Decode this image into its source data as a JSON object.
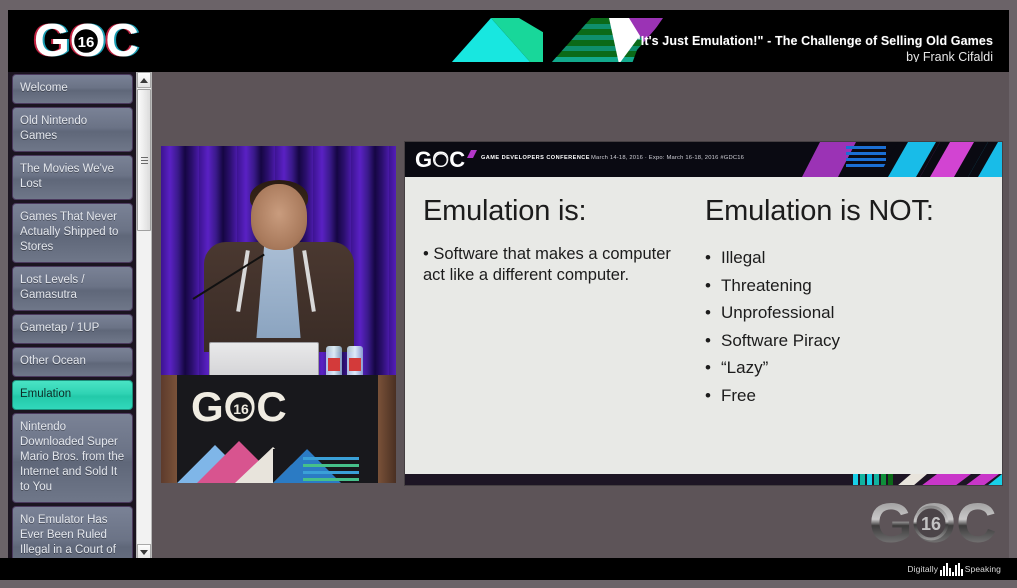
{
  "window": {
    "chrome_color": "#6b6368",
    "background_color": "#5d5458"
  },
  "header": {
    "logo_text": "GDC",
    "logo_year": "16",
    "title": "\"It's Just Emulation!\" - The Challenge of Selling Old Games",
    "subtitle": "by Frank Cifaldi",
    "background_color": "#000000",
    "accent_colors": [
      "#18e3d2",
      "#00b98a",
      "#0d6b1f",
      "#9b33b5",
      "#ffffff"
    ]
  },
  "sidebar": {
    "active_index": 7,
    "active_color": "#2fd3b4",
    "item_color": "#6b7386",
    "items": [
      {
        "label": "Welcome"
      },
      {
        "label": "Old Nintendo Games"
      },
      {
        "label": "The Movies We've Lost"
      },
      {
        "label": "Games That Never Actually Shipped to Stores"
      },
      {
        "label": "Lost Levels / Gamasutra"
      },
      {
        "label": "Gametap / 1UP"
      },
      {
        "label": "Other Ocean"
      },
      {
        "label": "Emulation"
      },
      {
        "label": "Nintendo Downloaded Super Mario Bros. from the Internet and Sold It to You"
      },
      {
        "label": "No Emulator Has Ever Been Ruled Illegal in a Court of Law"
      }
    ]
  },
  "scrollbar": {
    "up_arrow": "scroll-up",
    "down_arrow": "scroll-down",
    "thumb": "scroll-thumb"
  },
  "video": {
    "description": "speaker-at-podium",
    "podium_logo_text": "GDC",
    "podium_logo_year": "16"
  },
  "slide": {
    "band": {
      "logo_text": "GDC",
      "conference": "GAME DEVELOPERS CONFERENCE",
      "dates": "March 14-18, 2016 · Expo: March 16-18, 2016  #GDC16"
    },
    "left": {
      "heading": "Emulation is:",
      "body": "• Software that makes a computer act like a different computer."
    },
    "right": {
      "heading": "Emulation is NOT:",
      "bullets": [
        "Illegal",
        "Threatening",
        "Unprofessional",
        "Software Piracy",
        "“Lazy”",
        "Free"
      ]
    }
  },
  "watermark": {
    "logo_text": "GDC",
    "logo_year": "16"
  },
  "footer": {
    "brand_first": "Digitally",
    "brand_second": "Speaking",
    "background_color": "#000000"
  }
}
